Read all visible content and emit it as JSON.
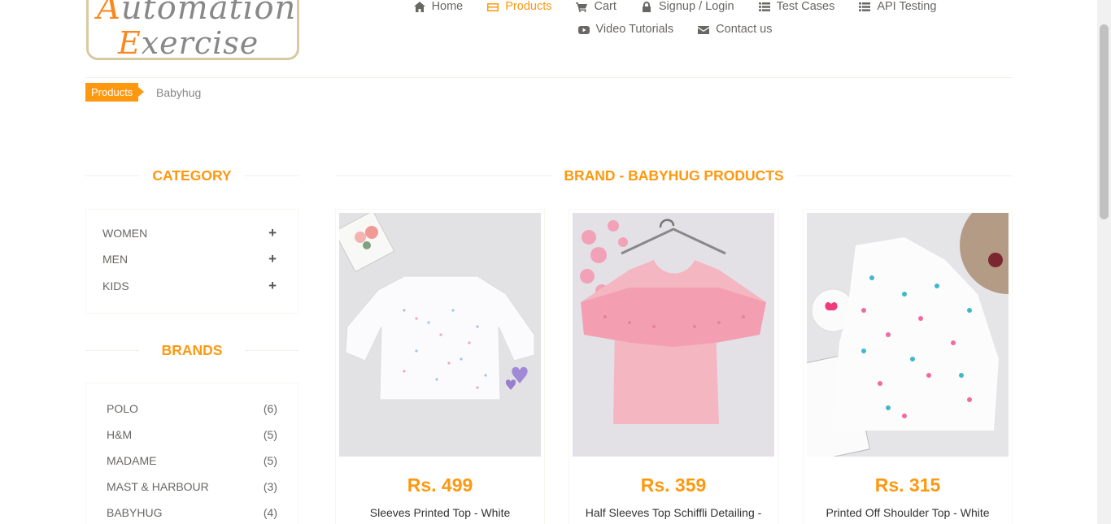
{
  "logo": {
    "line1": "Automation",
    "line2": "Exercise"
  },
  "nav": {
    "row1": [
      {
        "label": "Home",
        "icon": "home-icon",
        "active": false
      },
      {
        "label": "Products",
        "icon": "products-icon",
        "active": true
      },
      {
        "label": "Cart",
        "icon": "cart-icon",
        "active": false
      },
      {
        "label": "Signup / Login",
        "icon": "lock-icon",
        "active": false
      },
      {
        "label": "Test Cases",
        "icon": "list-icon",
        "active": false
      },
      {
        "label": "API Testing",
        "icon": "list-icon",
        "active": false
      }
    ],
    "row2": [
      {
        "label": "Video Tutorials",
        "icon": "youtube-icon"
      },
      {
        "label": "Contact us",
        "icon": "envelope-icon"
      }
    ]
  },
  "breadcrumb": {
    "parent": "Products",
    "current": "Babyhug"
  },
  "sidebar": {
    "category_title": "CATEGORY",
    "categories": [
      "Women",
      "Men",
      "Kids"
    ],
    "brands_title": "BRANDS",
    "brands": [
      {
        "name": "POLO",
        "count": "(6)"
      },
      {
        "name": "H&M",
        "count": "(5)"
      },
      {
        "name": "MADAME",
        "count": "(5)"
      },
      {
        "name": "MAST & HARBOUR",
        "count": "(3)"
      },
      {
        "name": "BABYHUG",
        "count": "(4)"
      }
    ]
  },
  "main": {
    "title": "BRAND - BABYHUG PRODUCTS",
    "products": [
      {
        "price": "Rs. 499",
        "name": "Sleeves Printed Top - White"
      },
      {
        "price": "Rs. 359",
        "name": "Half Sleeves Top Schiffli Detailing - Pink"
      },
      {
        "price": "Rs. 315",
        "name": "Printed Off Shoulder Top - White"
      }
    ]
  },
  "colors": {
    "accent": "#fe980f",
    "text": "#696763"
  }
}
